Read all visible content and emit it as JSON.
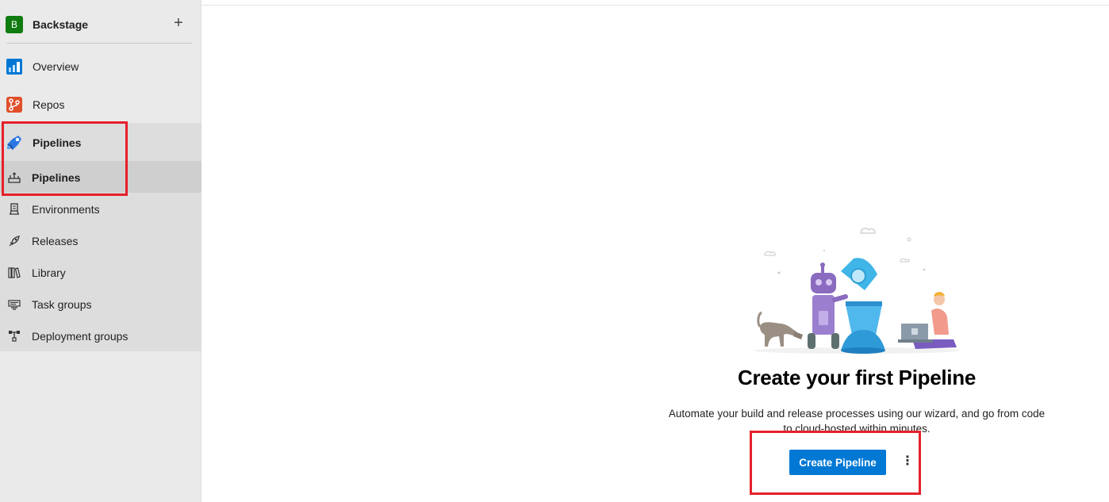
{
  "project": {
    "initial": "B",
    "name": "Backstage",
    "add_symbol": "+"
  },
  "nav": {
    "overview": "Overview",
    "repos": "Repos",
    "pipelines": "Pipelines"
  },
  "pipelines_menu": {
    "pipelines": "Pipelines",
    "environments": "Environments",
    "releases": "Releases",
    "library": "Library",
    "task_groups": "Task groups",
    "deployment_groups": "Deployment groups"
  },
  "main": {
    "heading": "Create your first Pipeline",
    "description": "Automate your build and release processes using our wizard, and go from code to cloud-hosted within minutes.",
    "create_button": "Create Pipeline",
    "more_symbol": "⋮"
  },
  "colors": {
    "accent": "#0078d4",
    "highlight": "#e5202a",
    "project_avatar": "#107c10"
  }
}
